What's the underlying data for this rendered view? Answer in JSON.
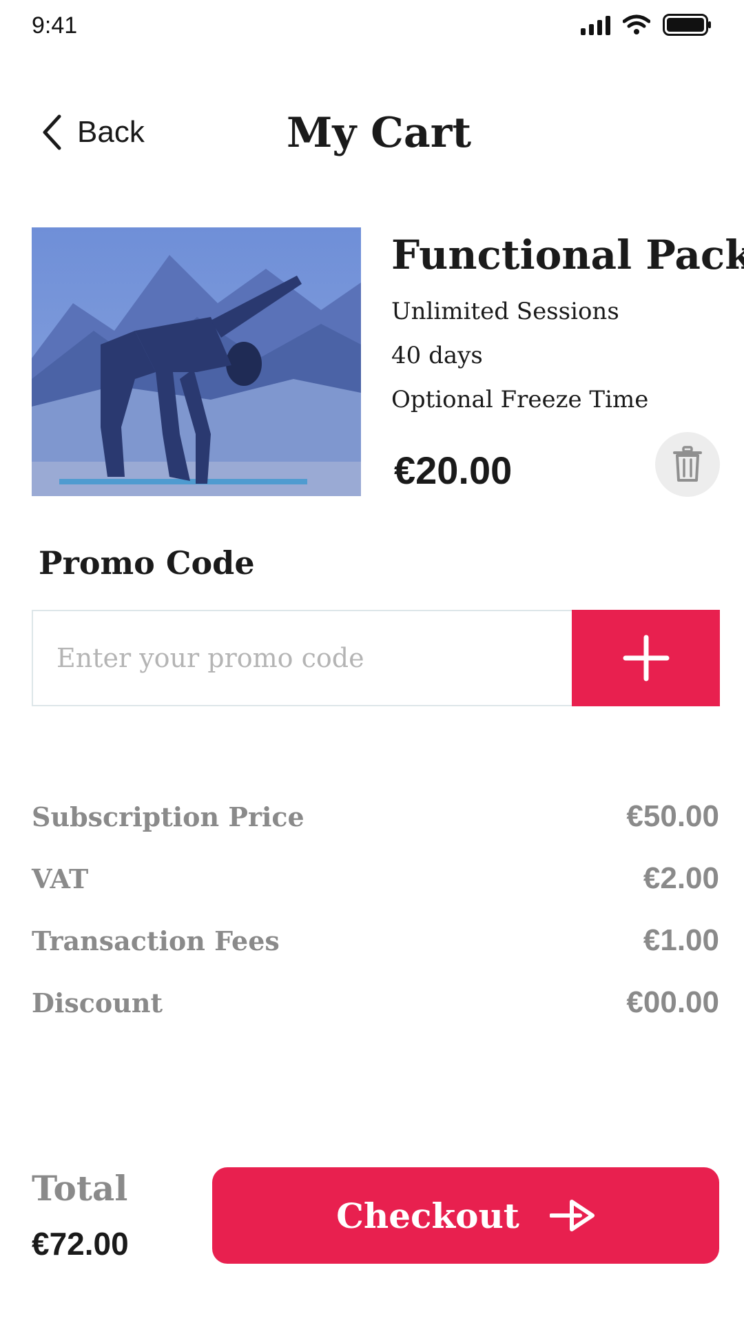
{
  "status_bar": {
    "time": "9:41"
  },
  "header": {
    "back_label": "Back",
    "title": "My Cart"
  },
  "product": {
    "title": "Functional Pack",
    "features": [
      "Unlimited Sessions",
      "40 days",
      "Optional Freeze Time"
    ],
    "price": "€20.00",
    "image_description": "yoga-pose-mountain-photo"
  },
  "promo": {
    "heading": "Promo Code",
    "placeholder": "Enter your promo code",
    "value": ""
  },
  "summary": [
    {
      "label": "Subscription Price",
      "value": "€50.00"
    },
    {
      "label": "VAT",
      "value": "€2.00"
    },
    {
      "label": "Transaction Fees",
      "value": "€1.00"
    },
    {
      "label": "Discount",
      "value": "€00.00"
    }
  ],
  "footer": {
    "total_label": "Total",
    "total_value": "€72.00",
    "checkout_label": "Checkout"
  },
  "icons": {
    "back": "chevron-left-icon",
    "delete": "trash-icon",
    "add": "plus-icon",
    "checkout": "arrow-right-icon",
    "signal": "cellular-signal-icon",
    "wifi": "wifi-icon",
    "battery": "battery-icon"
  },
  "colors": {
    "accent": "#e8204f",
    "muted_text": "#8a8a8a",
    "input_border": "#dde6e9"
  }
}
